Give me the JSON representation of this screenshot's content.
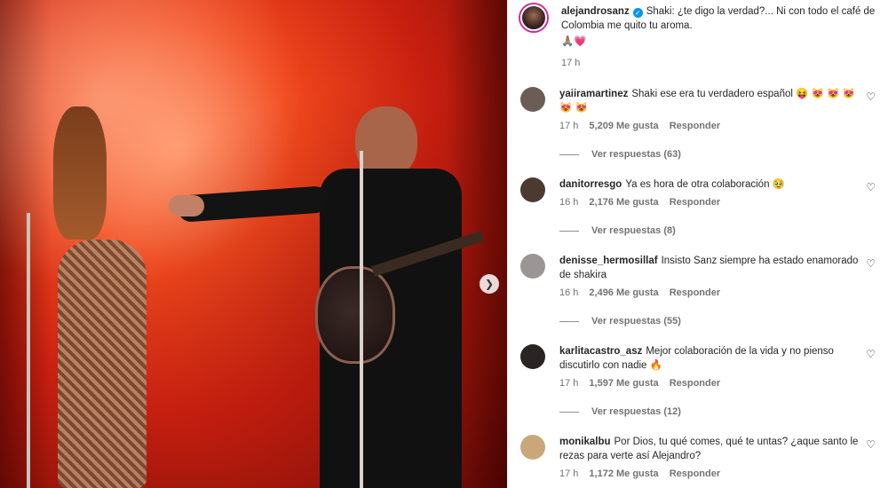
{
  "media": {
    "next_icon": "chevron-right-icon"
  },
  "caption": {
    "username": "alejandrosanz",
    "verified": true,
    "text": "Shaki: ¿te digo la verdad?... Ni con todo el café de Colombia me quito tu aroma.",
    "emojis": "🙏🏽💗",
    "time": "17 h"
  },
  "comments": [
    {
      "username": "yaiiramartinez",
      "text": "Shaki ese era tu verdadero español 😝 😻 😻 😻 😻 😻",
      "time": "17 h",
      "likes": "5,209 Me gusta",
      "reply": "Responder",
      "view_replies": "Ver respuestas (63)",
      "avatar_color": "#6b5d55"
    },
    {
      "username": "danitorresgo",
      "text": "Ya es hora de otra colaboración 🥹",
      "time": "16 h",
      "likes": "2,176 Me gusta",
      "reply": "Responder",
      "view_replies": "Ver respuestas (8)",
      "avatar_color": "#4c3a30"
    },
    {
      "username": "denisse_hermosillaf",
      "text": "Insisto Sanz siempre ha estado enamorado de shakira",
      "time": "16 h",
      "likes": "2,496 Me gusta",
      "reply": "Responder",
      "view_replies": "Ver respuestas (55)",
      "avatar_color": "#9b9595"
    },
    {
      "username": "karlitacastro_asz",
      "text": "Mejor colaboración de la vida y no pienso discutirlo con nadie 🔥",
      "time": "17 h",
      "likes": "1,597 Me gusta",
      "reply": "Responder",
      "view_replies": "Ver respuestas (12)",
      "avatar_color": "#2a2422"
    },
    {
      "username": "monikalbu",
      "text": "Por Dios, tu qué comes, qué te untas? ¿aque santo le rezas para verte así Alejandro?",
      "time": "17 h",
      "likes": "1,172 Me gusta",
      "reply": "Responder",
      "view_replies": "",
      "avatar_color": "#c9a77a"
    }
  ]
}
